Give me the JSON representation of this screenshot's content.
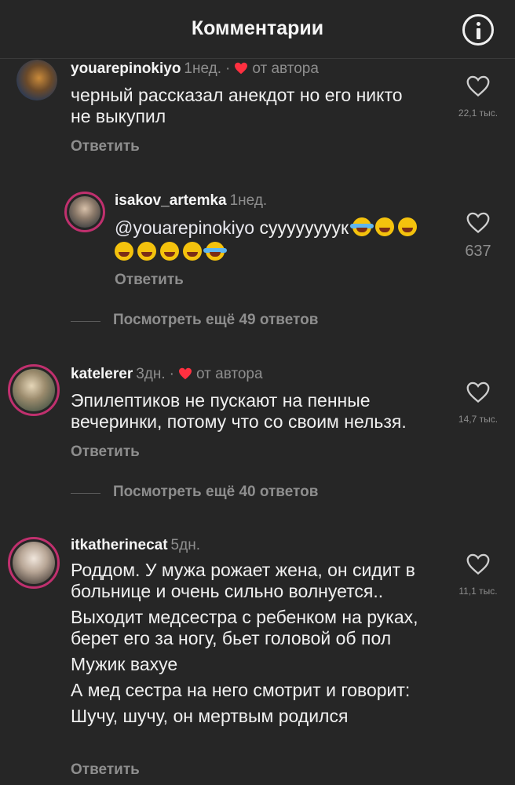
{
  "header": {
    "title": "Комментарии",
    "info_icon": "info-icon"
  },
  "comments": [
    {
      "username": "youarepinokiyo",
      "time": "1нед.",
      "separator": "·",
      "author_badge": "от автора",
      "text": [
        "черный рассказал анекдот но его никто",
        "не выкупил"
      ],
      "reply": "Ответить",
      "likes": "22,1 тыс."
    },
    {
      "username": "isakov_artemka",
      "time": "1нед.",
      "mention": "@youarepinokiyo",
      "text": "суууууууук",
      "reply": "Ответить",
      "likes": "637"
    },
    {
      "username": "katelerer",
      "time": "3дн.",
      "separator": "·",
      "author_badge": "от автора",
      "text": [
        "Эпилептиков не пускают на пенные",
        "вечеринки, потому что со своим нельзя."
      ],
      "reply": "Ответить",
      "likes": "14,7 тыс."
    },
    {
      "username": "itkatherinecat",
      "time": "5дн.",
      "text": [
        "Роддом. У мужа рожает жена, он сидит в больнице и очень сильно волнуется..",
        "Выходит медсестра с ребенком на руках, берет его за ногу, бьет головой об пол",
        "Мужик вахуе",
        "А мед сестра на него смотрит и говорит:",
        "Шучу, шучу, он мертвым родился"
      ],
      "reply": "Ответить",
      "likes": "11,1 тыс."
    }
  ],
  "view_more": [
    "Посмотреть ещё 49 ответов",
    "Посмотреть ещё 40 ответов"
  ],
  "colors": {
    "background": "#262626",
    "heart_red": "#ff3040",
    "secondary_text": "#8e8e8e",
    "story_ring": "#c0306e"
  }
}
